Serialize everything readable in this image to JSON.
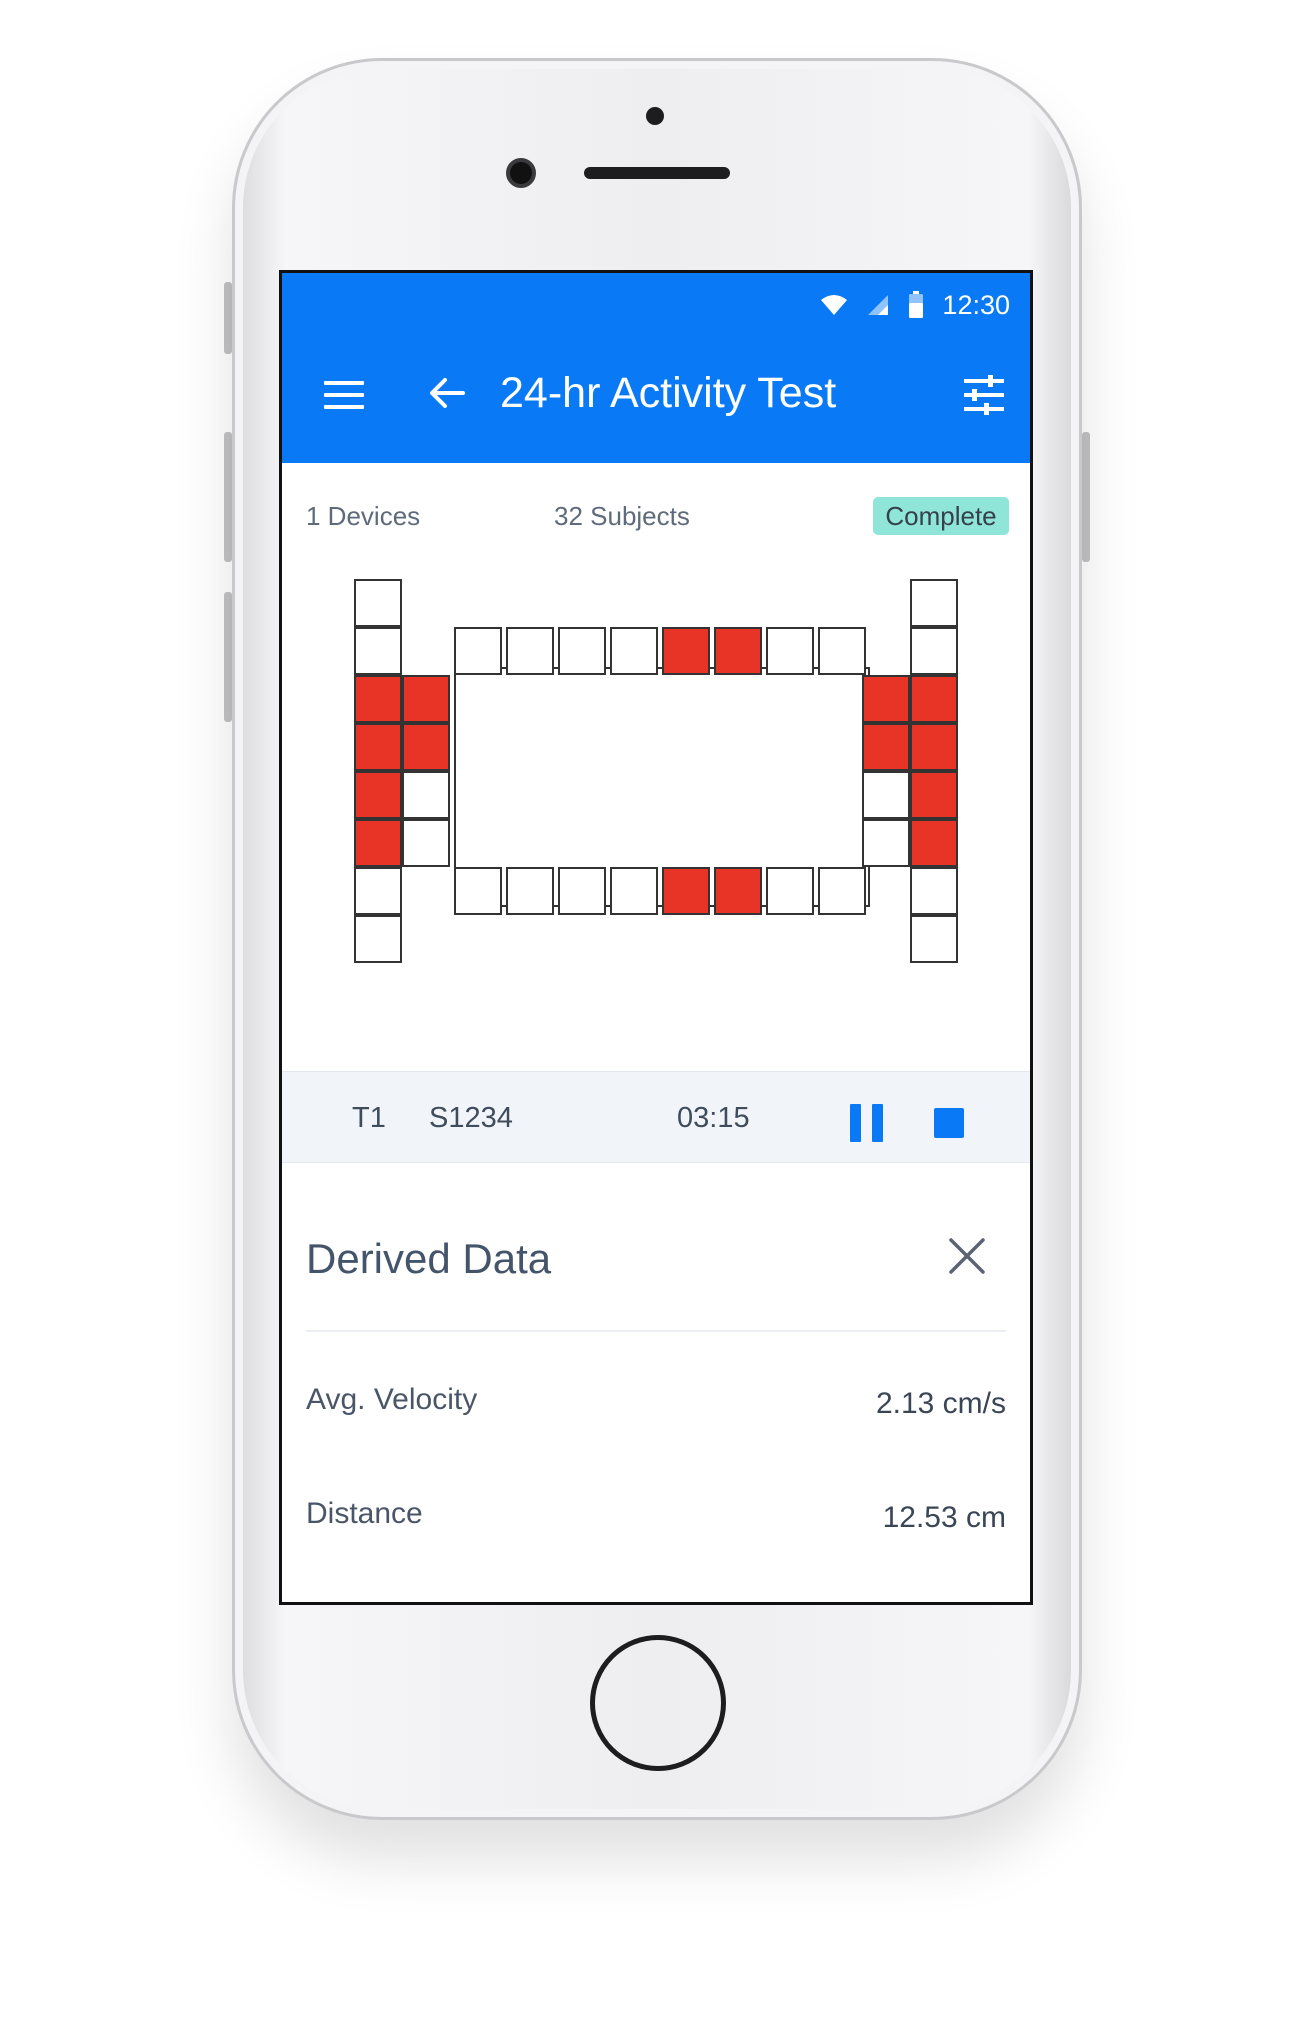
{
  "status_bar": {
    "time": "12:30",
    "icons": [
      "wifi-icon",
      "signal-icon",
      "battery-icon"
    ]
  },
  "toolbar": {
    "title": "24-hr Activity Test",
    "icons": [
      "menu-icon",
      "back-arrow-icon",
      "filter-sliders-icon"
    ]
  },
  "summary": {
    "devices": "1 Devices",
    "subjects": "32 Subjects",
    "status_badge": "Complete"
  },
  "arena": {
    "note": "Activity grid of sensor cells; red cells are active",
    "active_color": "#e83427",
    "inactive_color": "#ffffff",
    "top_row": [
      false,
      false,
      false,
      false,
      true,
      true,
      false,
      false
    ],
    "bottom_row": [
      false,
      false,
      false,
      false,
      true,
      true,
      false,
      false
    ],
    "left_outer_column": [
      false,
      false,
      true,
      true,
      true,
      true,
      false,
      false
    ],
    "left_inner_column": [
      true,
      true,
      false,
      false
    ],
    "right_inner_column": [
      true,
      true,
      false,
      false
    ],
    "right_outer_column": [
      false,
      false,
      true,
      true,
      true,
      true,
      false,
      false
    ]
  },
  "playback": {
    "track": "T1",
    "subject": "S1234",
    "elapsed": "03:15",
    "controls": [
      "pause-icon",
      "stop-icon"
    ]
  },
  "derived_data": {
    "title": "Derived Data",
    "rows": [
      {
        "label": "Avg. Velocity",
        "value": "2.13 cm/s"
      },
      {
        "label": "Distance",
        "value": "12.53 cm"
      }
    ]
  },
  "colors": {
    "primary": "#0a79f6",
    "badge_bg": "#8fe6d8",
    "active_cell": "#e83427"
  }
}
